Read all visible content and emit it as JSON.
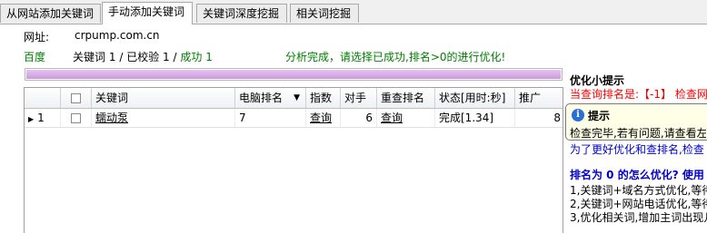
{
  "tabs": [
    {
      "label": "从网站添加关键词"
    },
    {
      "label": "手动添加关键词"
    },
    {
      "label": "关键词深度挖掘"
    },
    {
      "label": "相关词挖掘"
    }
  ],
  "site": {
    "label": "网址:",
    "value": "crpump.com.cn"
  },
  "engine": "百度",
  "stats": {
    "keywords_label": "关键词",
    "keywords": "1",
    "checked_label": "已校验",
    "checked": "1",
    "success_label": "成功",
    "success": "1"
  },
  "status_message": "分析完成，请选择已成功,排名>0的进行优化!",
  "progress": {
    "fraction": 1.0
  },
  "table": {
    "headers": [
      "",
      "",
      "关键词",
      "电脑排名",
      "指数",
      "对手",
      "重查排名",
      "状态[用时:秒]",
      "推广"
    ],
    "rows": [
      {
        "index": "1",
        "keyword": "蠕动泵",
        "rank": "7",
        "index_link": "查询",
        "rivals": "6",
        "recheck": "查询",
        "status": "完成[1.34]",
        "promo": "8"
      }
    ]
  },
  "panel": {
    "title": "优化小提示",
    "rank_line": "当查询排名是:【-1】 检查网",
    "partial_line": "为了更好优化和查排名,检查",
    "question": "排名为 0 的怎么优化? 使用",
    "tips": [
      "1,关键词+域名方式优化,等待",
      "2,关键词+网站电话优化,等待",
      "3,优化相关词,增加主词出现几"
    ]
  },
  "tooltip": {
    "title": "提示",
    "text": "检查完毕,若有问题,请查看左"
  }
}
